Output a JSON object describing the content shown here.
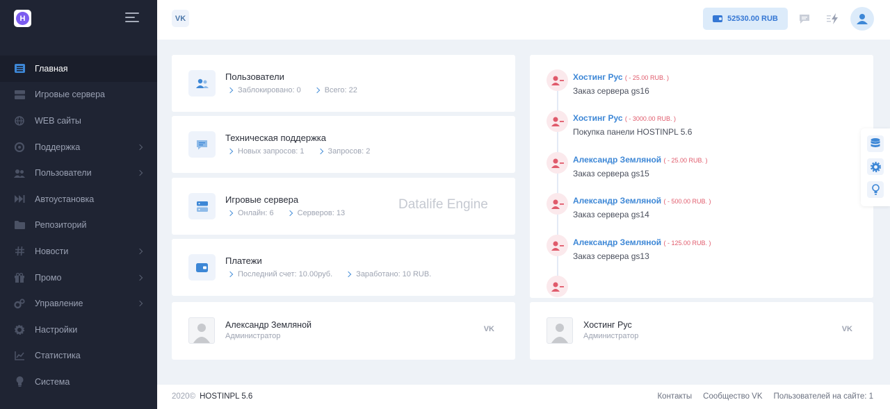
{
  "brand": {
    "logo_letter": "H"
  },
  "sidebar": {
    "items": [
      {
        "label": "Главная",
        "icon": "list-icon",
        "active": true,
        "chevron": false
      },
      {
        "label": "Игровые сервера",
        "icon": "server-icon",
        "active": false,
        "chevron": false
      },
      {
        "label": "WEB сайты",
        "icon": "globe-icon",
        "active": false,
        "chevron": false
      },
      {
        "label": "Поддержка",
        "icon": "lifebuoy-icon",
        "active": false,
        "chevron": true
      },
      {
        "label": "Пользователи",
        "icon": "users-icon",
        "active": false,
        "chevron": true
      },
      {
        "label": "Автоустановка",
        "icon": "fast-forward-icon",
        "active": false,
        "chevron": false
      },
      {
        "label": "Репозиторий",
        "icon": "folder-icon",
        "active": false,
        "chevron": false
      },
      {
        "label": "Новости",
        "icon": "hash-icon",
        "active": false,
        "chevron": true
      },
      {
        "label": "Промо",
        "icon": "gift-icon",
        "active": false,
        "chevron": true
      },
      {
        "label": "Управление",
        "icon": "cogs-icon",
        "active": false,
        "chevron": true
      },
      {
        "label": "Настройки",
        "icon": "gear-icon",
        "active": false,
        "chevron": false
      },
      {
        "label": "Статистика",
        "icon": "chart-icon",
        "active": false,
        "chevron": false
      },
      {
        "label": "Система",
        "icon": "bulb-icon",
        "active": false,
        "chevron": false
      }
    ]
  },
  "header": {
    "vk_label": "VK",
    "balance": "52530.00 RUB"
  },
  "stats": [
    {
      "title": "Пользователи",
      "icon": "users-icon",
      "sub": [
        "Заблокировано: 0",
        "Всего: 22"
      ]
    },
    {
      "title": "Техническая поддержка",
      "icon": "message-icon",
      "sub": [
        "Новых запросов: 1",
        "Запросов: 2"
      ]
    },
    {
      "title": "Игровые сервера",
      "icon": "server-icon",
      "sub": [
        "Онлайн: 6",
        "Серверов: 13"
      ],
      "watermark": "Datalife Engine"
    },
    {
      "title": "Платежи",
      "icon": "wallet-icon",
      "sub": [
        "Последний счет: 10.00руб.",
        "Заработано: 10 RUB."
      ]
    }
  ],
  "timeline": [
    {
      "name": "Хостинг Рус",
      "amount": "( - 25.00 RUB. )",
      "desc": "Заказ сервера gs16"
    },
    {
      "name": "Хостинг Рус",
      "amount": "( - 3000.00 RUB. )",
      "desc": "Покупка панели HOSTINPL 5.6"
    },
    {
      "name": "Александр Земляной",
      "amount": "( - 25.00 RUB. )",
      "desc": "Заказ сервера gs15"
    },
    {
      "name": "Александр Земляной",
      "amount": "( - 500.00 RUB. )",
      "desc": "Заказ сервера gs14"
    },
    {
      "name": "Александр Земляной",
      "amount": "( - 125.00 RUB. )",
      "desc": "Заказ сервера gs13"
    }
  ],
  "admins": [
    {
      "name": "Александр Земляной",
      "role": "Администратор",
      "vk": "VK"
    },
    {
      "name": "Хостинг Рус",
      "role": "Администратор",
      "vk": "VK"
    }
  ],
  "footer": {
    "year": "2020©",
    "product": "HOSTINPL 5.6",
    "links": [
      "Контакты",
      "Сообщество VK",
      "Пользователей на сайте: 1"
    ]
  },
  "colors": {
    "sidebar_bg": "#1f2433",
    "accent": "#3d87d6",
    "negative": "#e05a6b",
    "page_bg": "#eef2f7"
  }
}
